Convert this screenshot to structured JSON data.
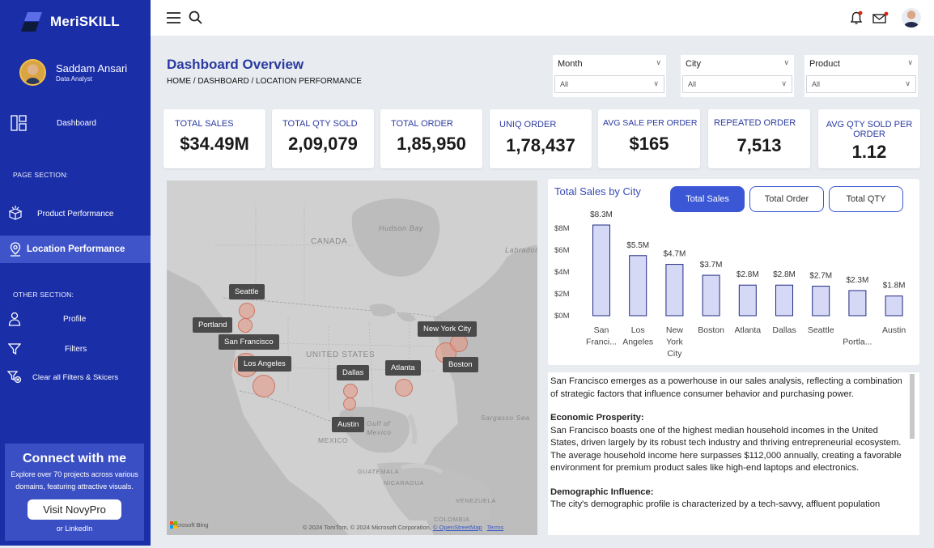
{
  "brand": {
    "name": "MeriSKILL"
  },
  "user": {
    "name": "Saddam Ansari",
    "role": "Data Analyst"
  },
  "nav": {
    "dashboard": "Dashboard",
    "page_section": "PAGE SECTION:",
    "product": "Product Performance",
    "location": "Location Performance",
    "other_section": "OTHER SECTION:",
    "profile": "Profile",
    "filters": "Filters",
    "clear": "Clear all Filters & Skicers"
  },
  "connect": {
    "title": "Connect with me",
    "desc": "Explore over 70 projects across various domains, featuring attractive visuals.",
    "button": "Visit NovyPro",
    "linkedin": "or LinkedIn"
  },
  "header": {
    "title": "Dashboard Overview",
    "breadcrumb": "HOME / DASHBOARD / LOCATION PERFORMANCE"
  },
  "filters": [
    {
      "label": "Month",
      "value": "All"
    },
    {
      "label": "City",
      "value": "All"
    },
    {
      "label": "Product",
      "value": "All"
    }
  ],
  "kpis": [
    {
      "label": "TOTAL SALES",
      "value": "$34.49M"
    },
    {
      "label": "TOTAL QTY SOLD",
      "value": "2,09,079"
    },
    {
      "label": "TOTAL ORDER",
      "value": "1,85,950"
    },
    {
      "label": "UNIQ ORDER",
      "value": "1,78,437"
    },
    {
      "label": "AVG SALE PER ORDER",
      "value": "$165"
    },
    {
      "label": "REPEATED ORDER",
      "value": "7,513"
    },
    {
      "label": "AVG QTY SOLD PER ORDER",
      "value": "1.12"
    }
  ],
  "map": {
    "labels": {
      "canada": "CANADA",
      "usa": "UNITED STATES",
      "mexico": "MEXICO",
      "hudson": "Hudson Bay",
      "labrador": "Labrador",
      "sargasso": "Sargasso Sea",
      "gulf": "Gulf of Mexico",
      "guatemala": "GUATEMALA",
      "nicaragua": "NICARAGUA",
      "venezuela": "VENEZUELA",
      "colombia": "COLOMBIA"
    },
    "cities": [
      "Seattle",
      "Portland",
      "San Francisco",
      "Los Angeles",
      "Dallas",
      "Atlanta",
      "New York City",
      "Boston",
      "Austin"
    ],
    "attribution": "© 2024 TomTom, © 2024 Microsoft Corporation,",
    "osm": "© OpenStreetMap",
    "terms": "Terms",
    "bing": "Microsoft Bing"
  },
  "chart_card": {
    "title": "Total Sales by City",
    "toggles": [
      "Total Sales",
      "Total Order",
      "Total QTY"
    ],
    "active": "Total Sales"
  },
  "chart_data": {
    "type": "bar",
    "title": "Total Sales by City",
    "categories": [
      "San Franci...",
      "Los Angeles",
      "New York City",
      "Boston",
      "Atlanta",
      "Dallas",
      "Seattle",
      "Portla...",
      "Austin"
    ],
    "values": [
      8.3,
      5.5,
      4.7,
      3.7,
      2.8,
      2.8,
      2.7,
      2.3,
      1.8
    ],
    "data_labels": [
      "$8.3M",
      "$5.5M",
      "$4.7M",
      "$3.7M",
      "$2.8M",
      "$2.8M",
      "$2.7M",
      "$2.3M",
      "$1.8M"
    ],
    "yticks": [
      "$8M",
      "$6M",
      "$4M",
      "$2M",
      "$0M"
    ],
    "ylim": [
      0,
      8.3
    ],
    "unit": "$M",
    "bar_color": "#d6d9f5",
    "bar_border": "#1f2a80"
  },
  "analysis": {
    "intro": "San Francisco emerges as a powerhouse in our sales analysis, reflecting a combination of strategic factors that influence consumer behavior and purchasing power.",
    "h1": "Economic Prosperity:",
    "p1": "San Francisco boasts one of the highest median household incomes in the United States, driven largely by its robust tech industry and thriving entrepreneurial ecosystem. The average household income here surpasses $112,000 annually, creating a favorable environment for premium product sales like high-end laptops and electronics.",
    "h2": "Demographic Influence:",
    "p2": "The city's demographic profile is characterized by a tech-savvy, affluent population"
  }
}
